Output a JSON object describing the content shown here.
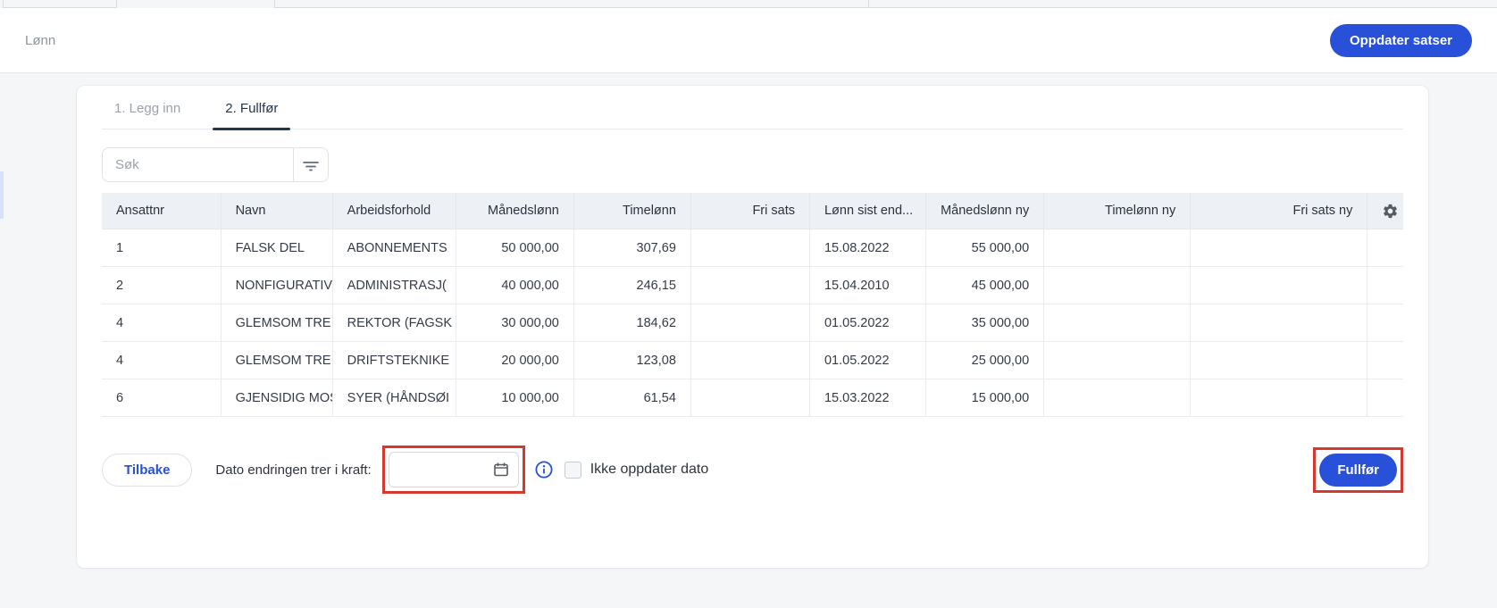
{
  "header": {
    "title": "Lønn",
    "update_button": "Oppdater satser"
  },
  "tabs": [
    {
      "label": "1. Legg inn",
      "active": false
    },
    {
      "label": "2. Fullfør",
      "active": true
    }
  ],
  "search": {
    "placeholder": "Søk"
  },
  "table": {
    "columns": [
      {
        "label": "Ansattnr",
        "align": "left"
      },
      {
        "label": "Navn",
        "align": "left"
      },
      {
        "label": "Arbeidsforhold",
        "align": "left"
      },
      {
        "label": "Månedslønn",
        "align": "right"
      },
      {
        "label": "Timelønn",
        "align": "right"
      },
      {
        "label": "Fri sats",
        "align": "right"
      },
      {
        "label": "Lønn sist end...",
        "align": "left"
      },
      {
        "label": "Månedslønn ny",
        "align": "right"
      },
      {
        "label": "Timelønn ny",
        "align": "right"
      },
      {
        "label": "Fri sats ny",
        "align": "right"
      },
      {
        "label": "",
        "align": "center",
        "icon": "gear-icon"
      }
    ],
    "rows": [
      [
        "1",
        "FALSK DEL",
        "ABONNEMENTS",
        "50 000,00",
        "307,69",
        "",
        "15.08.2022",
        "55 000,00",
        "",
        ""
      ],
      [
        "2",
        "NONFIGURATIV",
        "ADMINISTRASJ(",
        "40 000,00",
        "246,15",
        "",
        "15.04.2010",
        "45 000,00",
        "",
        ""
      ],
      [
        "4",
        "GLEMSOM TRE",
        "REKTOR (FAGSK",
        "30 000,00",
        "184,62",
        "",
        "01.05.2022",
        "35 000,00",
        "",
        ""
      ],
      [
        "4",
        "GLEMSOM TRE",
        "DRIFTSTEKNIKE",
        "20 000,00",
        "123,08",
        "",
        "01.05.2022",
        "25 000,00",
        "",
        ""
      ],
      [
        "6",
        "GJENSIDIG MOS",
        "SYER (HÅNDSØI",
        "10 000,00",
        "61,54",
        "",
        "15.03.2022",
        "15 000,00",
        "",
        ""
      ]
    ]
  },
  "footer": {
    "back_button": "Tilbake",
    "date_label": "Dato endringen trer i kraft:",
    "date_value": "",
    "checkbox_label": "Ikke oppdater dato",
    "checkbox_checked": false,
    "submit_button": "Fullfør"
  },
  "colors": {
    "primary_blue": "#2850d8",
    "highlight_red": "#d5382c",
    "active_tab": "#24364f",
    "table_header_bg": "#edf1f6",
    "page_bg": "#f4f6f8"
  }
}
